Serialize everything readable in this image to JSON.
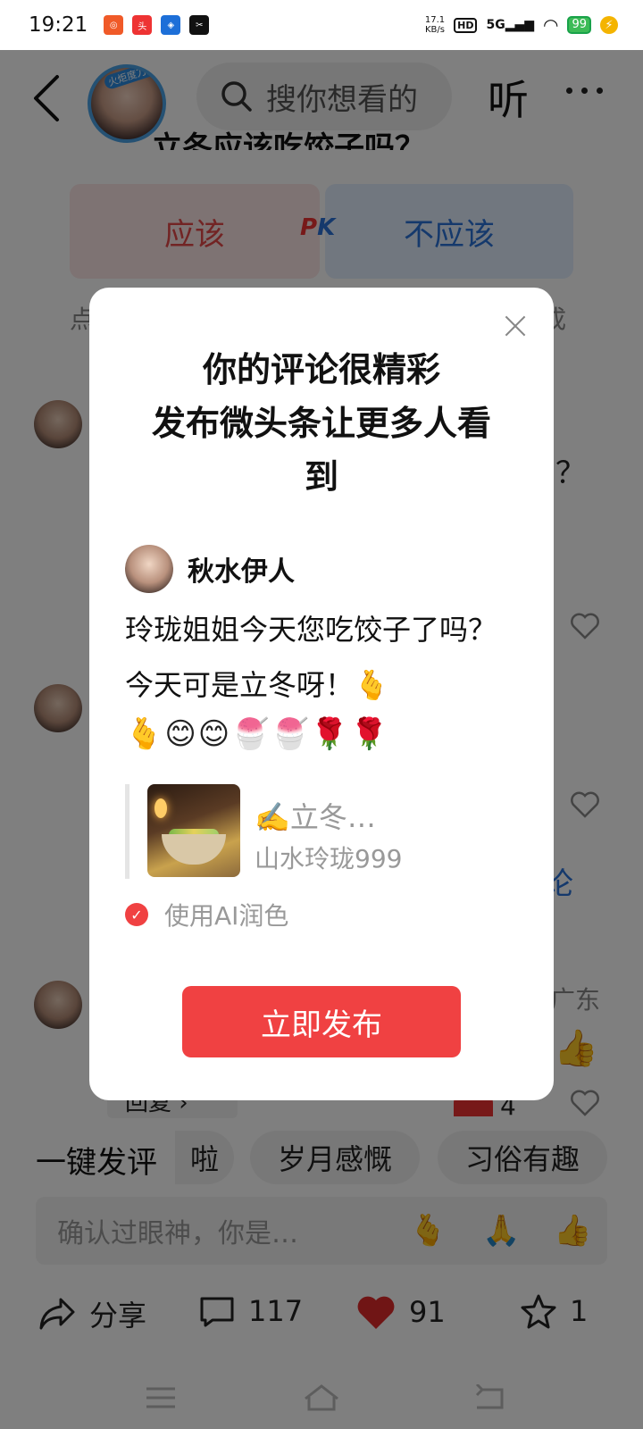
{
  "status_bar": {
    "time": "19:21",
    "net_speed_value": "17.1",
    "net_speed_unit": "KB/s",
    "hd": "HD",
    "network": "5G",
    "battery": "99"
  },
  "header": {
    "avatar_badge": "火炬度刀侠",
    "search_placeholder": "搜你想看的",
    "listen_label": "听"
  },
  "background": {
    "question_title": "立冬应该吃饺子吗？",
    "pk_left": "应该",
    "pk_right": "不应该",
    "pk_badge_p": "P",
    "pk_badge_k": "K",
    "left_fragment": "点",
    "right_fragment": "成",
    "question_mark": "？",
    "comment_blue_fragment": "论",
    "region_fragment": "广东",
    "reply_label": "回复 ›",
    "like_count": "4"
  },
  "quick_comments": {
    "title": "一键发评",
    "chips": [
      "啦",
      "岁月感慨",
      "习俗有趣"
    ]
  },
  "comment_input": {
    "placeholder": "确认过眼神，你是…",
    "emojis": [
      "🫰",
      "🙏",
      "👍"
    ]
  },
  "action_bar": {
    "share_label": "分享",
    "comment_count": "117",
    "like_count": "91",
    "favorite_count": "1"
  },
  "modal": {
    "title_line1": "你的评论很精彩",
    "title_line2": "发布微头条让更多人看",
    "title_line3": "到",
    "username": "秋水伊人",
    "comment_text": "玲珑姐姐今天您吃饺子了吗？今天可是立冬呀！🫰",
    "emoji_row": "🫰😊😊🍧🍧🌹🌹",
    "quote_title": "✍️立冬…",
    "quote_author": "山水玲珑999",
    "ai_checkbox_label": "使用AI润色",
    "ai_checked": true,
    "publish_button": "立即发布"
  },
  "colors": {
    "accent_red": "#f04142",
    "blue": "#2a72d8",
    "overlay": "rgba(0,0,0,0.5)"
  }
}
